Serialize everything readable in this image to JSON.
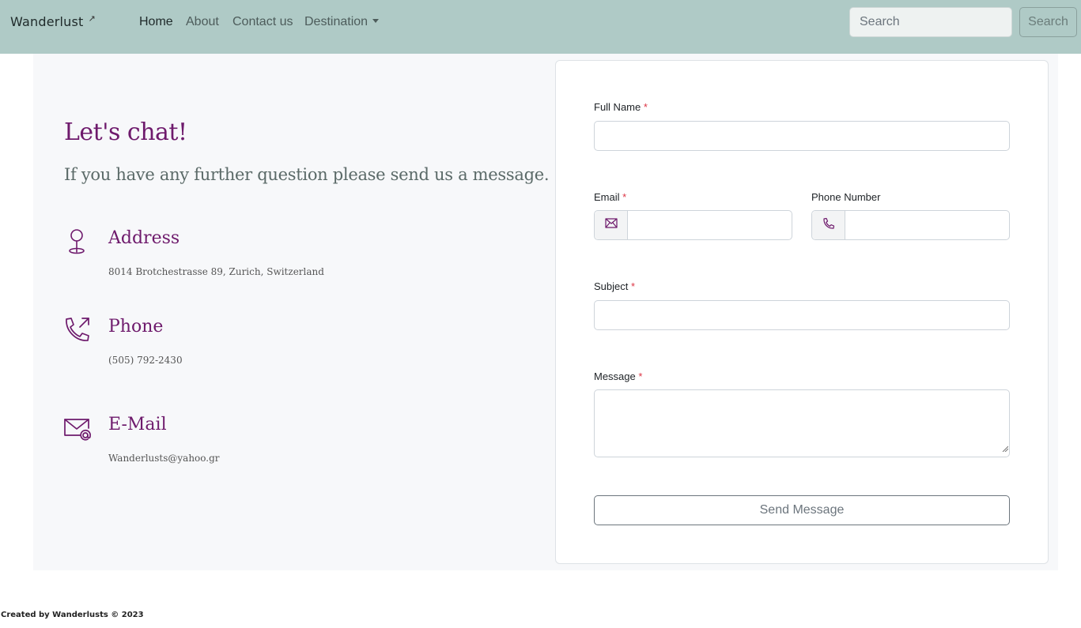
{
  "navbar": {
    "brand": "Wanderlust",
    "brand_mark": "↗",
    "links": [
      {
        "label": "Home"
      },
      {
        "label": "About"
      },
      {
        "label": "Contact us"
      },
      {
        "label": "Destination"
      }
    ],
    "search": {
      "placeholder": "Search",
      "button_label": "Search"
    }
  },
  "contact_info": {
    "headline": "Let's chat!",
    "subheadline": "If you have any further question please send us a message.",
    "address": {
      "title": "Address",
      "value": "8014 Brotchestrasse 89, Zurich, Switzerland",
      "icon": "map-pin-icon"
    },
    "phone": {
      "title": "Phone",
      "value": "(505) 792-2430",
      "icon": "phone-outgoing-icon"
    },
    "email": {
      "title": "E-Mail",
      "value": "Wanderlusts@yahoo.gr",
      "icon": "email-at-icon"
    }
  },
  "form": {
    "full_name_label": "Full Name",
    "email_label": "Email",
    "phone_label": "Phone Number",
    "subject_label": "Subject",
    "message_label": "Message",
    "required_marker": "*",
    "submit_label": "Send Message"
  },
  "footer": {
    "text": "Created by Wanderlusts © 2023"
  },
  "colors": {
    "navbar": "#afcac6",
    "accent": "#6e1a6c",
    "panel": "#f7f8fa",
    "required": "#dc3545"
  }
}
